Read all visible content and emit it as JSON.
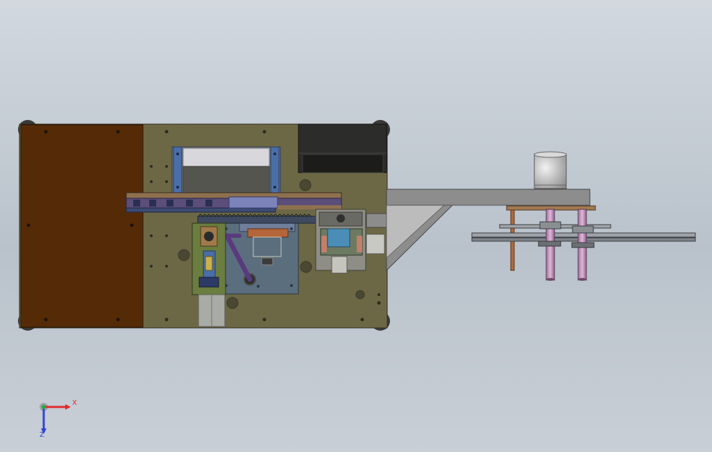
{
  "viewport": {
    "background_top": "#d2d8df",
    "background_bottom": "#b9c2cb"
  },
  "colors": {
    "base_plate": "#6c6845",
    "wood_panel": "#552a07",
    "dark_block": "#2c2c2a",
    "frame_arm": "#8c8c8c",
    "accent_blue": "#4a6ea8",
    "accent_purple": "#6a4a8e",
    "accent_pink": "#c590b8",
    "accent_copper": "#b06a3e"
  },
  "triad": {
    "x_label": "X",
    "z_label": "Z",
    "x_color": "#e0292f",
    "y_color": "#29a83b",
    "z_color": "#2f43d8"
  }
}
